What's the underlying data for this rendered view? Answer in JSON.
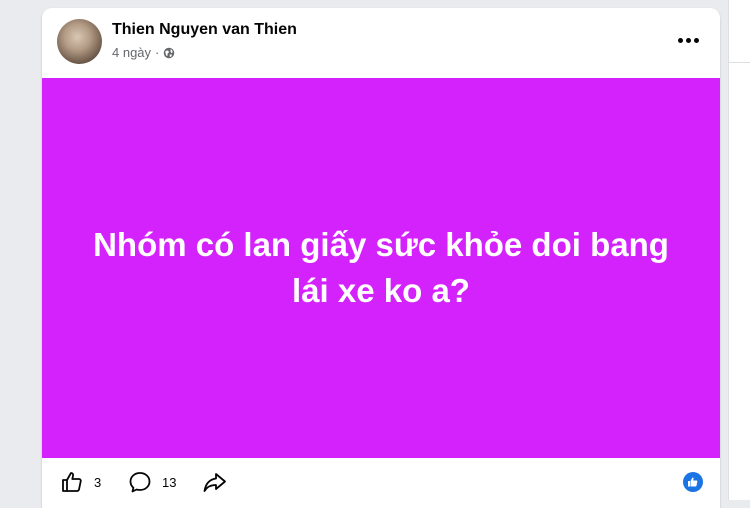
{
  "post": {
    "author": "Thien Nguyen van Thien",
    "time": "4 ngày",
    "separator": "·",
    "privacy_icon": "globe-icon",
    "text": "Nhóm có lan giấy sức khỏe doi bang lái xe ko a?",
    "background_color": "#d322fb"
  },
  "actions": {
    "like_icon": "thumbs-up-icon",
    "like_count": "3",
    "comment_icon": "comment-icon",
    "comment_count": "13",
    "share_icon": "share-icon",
    "reaction_badge_icon": "like-badge-icon"
  },
  "colors": {
    "accent": "#1b74e4",
    "text_primary": "#050505",
    "text_secondary": "#65676b"
  }
}
